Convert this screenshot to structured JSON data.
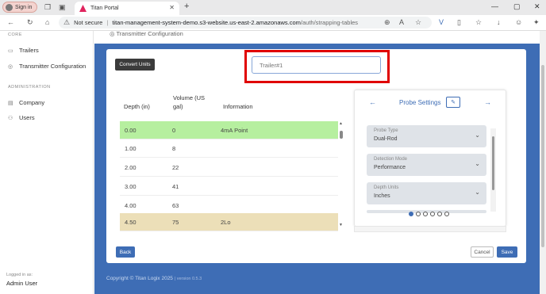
{
  "browser": {
    "profile_label": "Sign in",
    "tab_title": "Titan Portal",
    "tab_close": "✕",
    "new_tab": "+",
    "security_label": "Not secure",
    "url_host": "titan-management-system-demo.s3-website.us-east-2.amazonaws.com",
    "url_path": "/auth/strapping-tables",
    "minimize": "—",
    "maximize": "▢",
    "close": "✕"
  },
  "sidebar": {
    "section_core": "CORE",
    "items_core": [
      {
        "icon": "truck-icon",
        "glyph": "▭",
        "label": "Trailers"
      },
      {
        "icon": "broadcast-icon",
        "glyph": "◎",
        "label": "Transmitter Configuration"
      }
    ],
    "section_admin": "ADMINISTRATION",
    "items_admin": [
      {
        "icon": "building-icon",
        "glyph": "▤",
        "label": "Company"
      },
      {
        "icon": "users-icon",
        "glyph": "⚇",
        "label": "Users"
      }
    ],
    "logged_in_label": "Logged in as:",
    "user": "Admin User"
  },
  "main": {
    "cut_header": "Transmitter Configuration",
    "convert_units": "Convert Units",
    "trailer_placeholder": "Trailer#1",
    "table": {
      "headers": [
        "Depth (in)",
        "Volume (US gal)",
        "Information"
      ],
      "rows": [
        {
          "depth": "0.00",
          "volume": "0",
          "info": "4mA Point",
          "highlight": "#b6ef9f"
        },
        {
          "depth": "1.00",
          "volume": "8",
          "info": "",
          "highlight": ""
        },
        {
          "depth": "2.00",
          "volume": "22",
          "info": "",
          "highlight": ""
        },
        {
          "depth": "3.00",
          "volume": "41",
          "info": "",
          "highlight": ""
        },
        {
          "depth": "4.00",
          "volume": "63",
          "info": "",
          "highlight": ""
        },
        {
          "depth": "4.50",
          "volume": "75",
          "info": "2Lo",
          "highlight": "#ecdfb8"
        }
      ]
    },
    "settings": {
      "title": "Probe Settings",
      "edit_glyph": "✎",
      "prev": "←",
      "next": "→",
      "fields": [
        {
          "label": "Probe Type",
          "value": "Dual-Rod"
        },
        {
          "label": "Detection Mode",
          "value": "Performance"
        },
        {
          "label": "Depth Units",
          "value": "Inches"
        }
      ],
      "chevron": "⌄",
      "dot_count": 6,
      "active_dot": 0
    },
    "back": "Back",
    "cancel": "Cancel",
    "save": "Save",
    "copyright": "Copyright © Titan Logix 2025",
    "version": "| version 0.5.3"
  },
  "colors": {
    "brand_blue": "#3e6db5",
    "highlight_red": "#e00000"
  }
}
